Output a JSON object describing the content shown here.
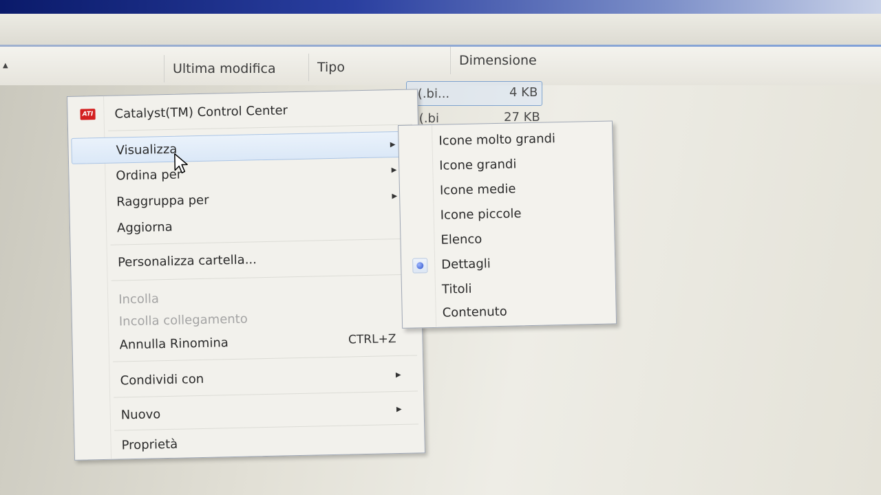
{
  "columns": {
    "modified": "Ultima modifica",
    "type": "Tipo",
    "size": "Dimensione"
  },
  "rows": [
    {
      "type_fragment": "e (.bi...",
      "size": "4 KB"
    },
    {
      "type_fragment": "e (.bi",
      "size": "27 KB"
    }
  ],
  "context_menu": {
    "catalyst": {
      "label": "Catalyst(TM) Control Center",
      "icon": "ati-icon"
    },
    "view": {
      "label": "Visualizza"
    },
    "sort_by": {
      "label": "Ordina per"
    },
    "group_by": {
      "label": "Raggruppa per"
    },
    "refresh": {
      "label": "Aggiorna"
    },
    "customize": {
      "label": "Personalizza cartella..."
    },
    "paste": {
      "label": "Incolla"
    },
    "paste_link": {
      "label": "Incolla collegamento"
    },
    "undo_rename": {
      "label": "Annulla Rinomina",
      "shortcut": "CTRL+Z"
    },
    "share_with": {
      "label": "Condividi con"
    },
    "new": {
      "label": "Nuovo"
    },
    "properties": {
      "label": "Proprietà"
    }
  },
  "view_submenu": {
    "items": [
      {
        "label": "Icone molto grandi"
      },
      {
        "label": "Icone grandi"
      },
      {
        "label": "Icone medie"
      },
      {
        "label": "Icone piccole"
      },
      {
        "label": "Elenco"
      },
      {
        "label": "Dettagli",
        "selected": true
      },
      {
        "label": "Titoli"
      },
      {
        "label": "Contenuto"
      }
    ]
  }
}
